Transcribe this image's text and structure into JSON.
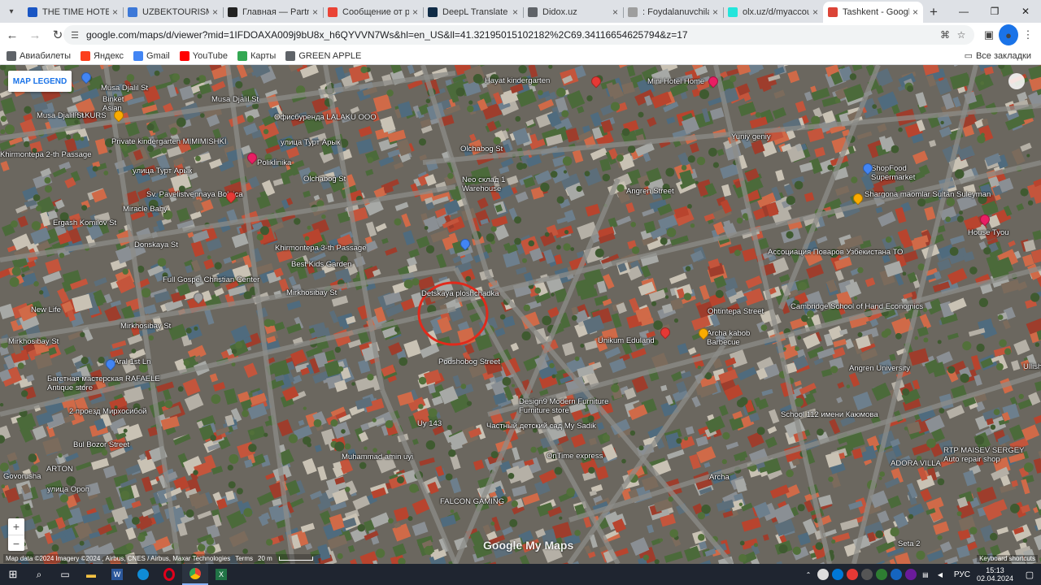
{
  "browser": {
    "tabs": [
      {
        "title": "THE TIME HOTEL -",
        "icon": "T",
        "color": "#1a56c4",
        "active": false
      },
      {
        "title": "UZBEKTOURISM",
        "icon": "U",
        "color": "#3c78d8",
        "active": false
      },
      {
        "title": "Главная — Partner C",
        "icon": "П",
        "color": "#222222",
        "active": false
      },
      {
        "title": "Сообщение от рабо",
        "icon": "M",
        "color": "#ea4335",
        "active": false
      },
      {
        "title": "DeepL Translate – Ca",
        "icon": "D",
        "color": "#0f2b46",
        "active": false
      },
      {
        "title": "Didox.uz",
        "icon": "D",
        "color": "#5f6368",
        "active": false
      },
      {
        "title": ": Foydalanuvchilarni",
        "icon": "F",
        "color": "#9e9e9e",
        "active": false
      },
      {
        "title": "olx.uz/d/myaccount/",
        "icon": "O",
        "color": "#23e5db",
        "active": false
      },
      {
        "title": "Tashkent - Google M",
        "icon": "M",
        "color": "#db4437",
        "active": true
      }
    ],
    "url": "google.com/maps/d/viewer?mid=1IFDOAXA009j9bU8x_h6QYVVN7Ws&hl=en_US&ll=41.32195015102182%2C69.34116654625794&z=17",
    "bookmarks": [
      {
        "label": "Авиабилеты",
        "icon": "globe-icon",
        "color": "#5f6368"
      },
      {
        "label": "Яндекс",
        "icon": "yandex-icon",
        "color": "#fc3f1d"
      },
      {
        "label": "Gmail",
        "icon": "google-icon",
        "color": "#4285f4"
      },
      {
        "label": "YouTube",
        "icon": "youtube-icon",
        "color": "#ff0000"
      },
      {
        "label": "Карты",
        "icon": "maps-icon",
        "color": "#34a853"
      },
      {
        "label": "GREEN APPLE",
        "icon": "globe-icon",
        "color": "#5f6368"
      }
    ],
    "all_bookmarks": "Все закладки"
  },
  "map": {
    "legend_button": "MAP LEGEND",
    "zoom_in": "+",
    "zoom_out": "−",
    "attribution": "Map data ©2024 Imagery ©2024 , Airbus, CNES / Airbus, Maxar Technologies",
    "terms": "Terms",
    "scale": "20 m",
    "watermark": "Google My Maps",
    "keyboard": "Keyboard shortcuts",
    "places": [
      {
        "name": "Binket",
        "sub": "Asian"
      },
      {
        "name": "RAKURS"
      },
      {
        "name": "Musa Djalil St"
      },
      {
        "name": "Musa Djalil St"
      },
      {
        "name": "Musa Djalil St"
      },
      {
        "name": "Khirmontepa 2-th Passage"
      },
      {
        "name": "Офисбуренда LALAKU OOO"
      },
      {
        "name": "Private kindergarten MIMIMISHKI"
      },
      {
        "name": "Poliklinika"
      },
      {
        "name": "Sv. Pavelistvennaya Bolnica"
      },
      {
        "name": "улица Турт Арык"
      },
      {
        "name": "улица Турт Арык"
      },
      {
        "name": "Ergash Komilov St"
      },
      {
        "name": "Miracle Baby"
      },
      {
        "name": "Donskaya St"
      },
      {
        "name": "Full Gospel Christian Center"
      },
      {
        "name": "New Life"
      },
      {
        "name": "Mirkhosibay St"
      },
      {
        "name": "Mirkhosibay St"
      },
      {
        "name": "Aral 1st Ln"
      },
      {
        "name": "Багетная мастерская RAFAELE",
        "sub": "Antique store"
      },
      {
        "name": "2 проезд Мирхосибой"
      },
      {
        "name": "Bul Bozor Street"
      },
      {
        "name": "ARTON"
      },
      {
        "name": "Govorusha"
      },
      {
        "name": "улица Ороп"
      },
      {
        "name": "Hayat kindergarten"
      },
      {
        "name": "Mini Hotel Home"
      },
      {
        "name": "Olchabog St"
      },
      {
        "name": "Olchabog St"
      },
      {
        "name": "Neo склад 1",
        "sub": "Warehouse"
      },
      {
        "name": "Khirmontepa 3-th Passage"
      },
      {
        "name": "Best Kids Garden"
      },
      {
        "name": "Mirkhosibay St"
      },
      {
        "name": "Detskaya ploshchadka"
      },
      {
        "name": "Yuniy geniy"
      },
      {
        "name": "ShopFood",
        "sub": "Supermarket"
      },
      {
        "name": "Shargona maomlar Sultan Suleyman"
      },
      {
        "name": "House Tyou"
      },
      {
        "name": "Ассоциация Поваров Узбекистана ТО"
      },
      {
        "name": "Cambridge School of Hand Economics"
      },
      {
        "name": "Archa kabob",
        "sub": "Barbecue"
      },
      {
        "name": "Unikum Eduland"
      },
      {
        "name": "Angren University"
      },
      {
        "name": "Design9 Modern Furniture",
        "sub": "Furniture store"
      },
      {
        "name": "Частный детский сад My Sadik"
      },
      {
        "name": "School 112 имени Каюмова"
      },
      {
        "name": "OnTime express"
      },
      {
        "name": "Uy 143"
      },
      {
        "name": "Muhammad amin uyi"
      },
      {
        "name": "Archa"
      },
      {
        "name": "RTP MAISEV SERGEY",
        "sub": "Auto repair shop"
      },
      {
        "name": "ADORA VILLA"
      },
      {
        "name": "FALCON GAMING"
      },
      {
        "name": "Seta 2"
      },
      {
        "name": "Ohtintepa Street"
      },
      {
        "name": "Podshobog Street"
      },
      {
        "name": "Angren Street"
      },
      {
        "name": "Ullish"
      }
    ]
  },
  "taskbar": {
    "lang": "РУС",
    "time": "15:13",
    "date": "02.04.2024"
  }
}
